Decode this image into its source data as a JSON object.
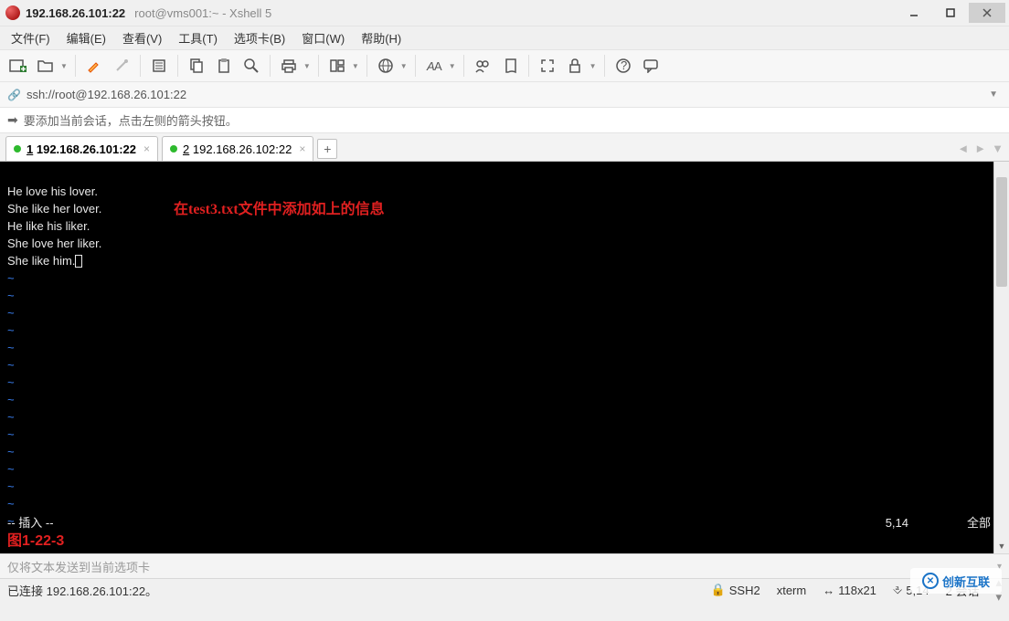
{
  "title": {
    "host": "192.168.26.101:22",
    "rest": "root@vms001:~ - Xshell 5"
  },
  "menu": [
    "文件(F)",
    "编辑(E)",
    "查看(V)",
    "工具(T)",
    "选项卡(B)",
    "窗口(W)",
    "帮助(H)"
  ],
  "address": "ssh://root@192.168.26.101:22",
  "hint": "要添加当前会话，点击左侧的箭头按钮。",
  "tabs": [
    {
      "num": "1",
      "label": "192.168.26.101:22",
      "active": true,
      "bold": true
    },
    {
      "num": "2",
      "label": "192.168.26.102:22",
      "active": false,
      "bold": false
    }
  ],
  "terminal": {
    "lines": [
      "He love his lover.",
      "She like her lover.",
      "He like his liker.",
      "She love her liker.",
      "She like him."
    ],
    "annotation": "在test3.txt文件中添加如上的信息",
    "vim_mode": "-- 插入 --",
    "vim_pos": "5,14",
    "vim_scope": "全部",
    "figure_label": "图1-22-3"
  },
  "sendbar": "仅将文本发送到当前选项卡",
  "status": {
    "conn": "已连接 192.168.26.101:22。",
    "proto": "SSH2",
    "term": "xterm",
    "size": "118x21",
    "cursor": "5,14",
    "sessions": "2 会话"
  },
  "watermark": "创新互联"
}
